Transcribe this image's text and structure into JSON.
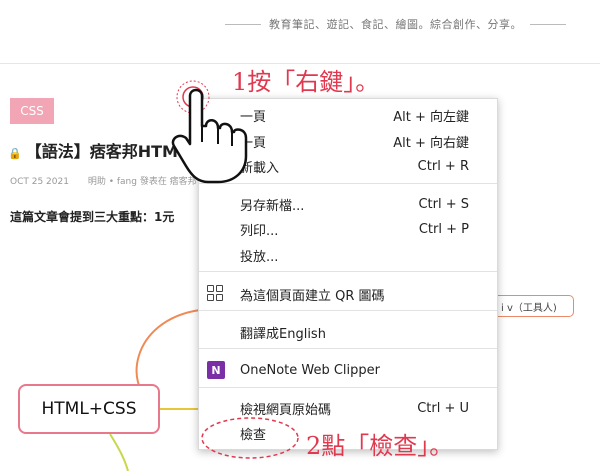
{
  "header": {
    "tagline": "教育筆記、遊記、食記、繪圖。綜合創作、分享。"
  },
  "post": {
    "category": "CSS",
    "title": "【語法】痞客邦HTML",
    "date": "OCT 25 2021",
    "author_line": "明助 • fang 發表在 痞客邦",
    "intro": "這篇文章會提到三大重點：1元"
  },
  "mindmap": {
    "main_node": "HTML+CSS",
    "side_node": "i v（工具人)"
  },
  "context_menu": {
    "items": [
      {
        "label": "一頁",
        "shortcut": "Alt + 向左鍵"
      },
      {
        "label": "一頁",
        "shortcut": "Alt + 向右鍵"
      },
      {
        "label": "新載入",
        "shortcut": "Ctrl + R"
      },
      {
        "label": "另存新檔...",
        "shortcut": "Ctrl + S"
      },
      {
        "label": "列印...",
        "shortcut": "Ctrl + P"
      },
      {
        "label": "投放...",
        "shortcut": ""
      },
      {
        "label": "為這個頁面建立 QR 圖碼",
        "shortcut": "",
        "icon": "qr-code-icon"
      },
      {
        "label": "翻譯成English",
        "shortcut": ""
      },
      {
        "label": "OneNote Web Clipper",
        "shortcut": "",
        "icon": "onenote-icon"
      },
      {
        "label": "檢視網頁原始碼",
        "shortcut": "Ctrl + U"
      },
      {
        "label": "檢查",
        "shortcut": ""
      }
    ]
  },
  "annotations": {
    "step1": "1按「右鍵」。",
    "step2": "2點「檢查」。",
    "accent_color": "#e0394f"
  }
}
